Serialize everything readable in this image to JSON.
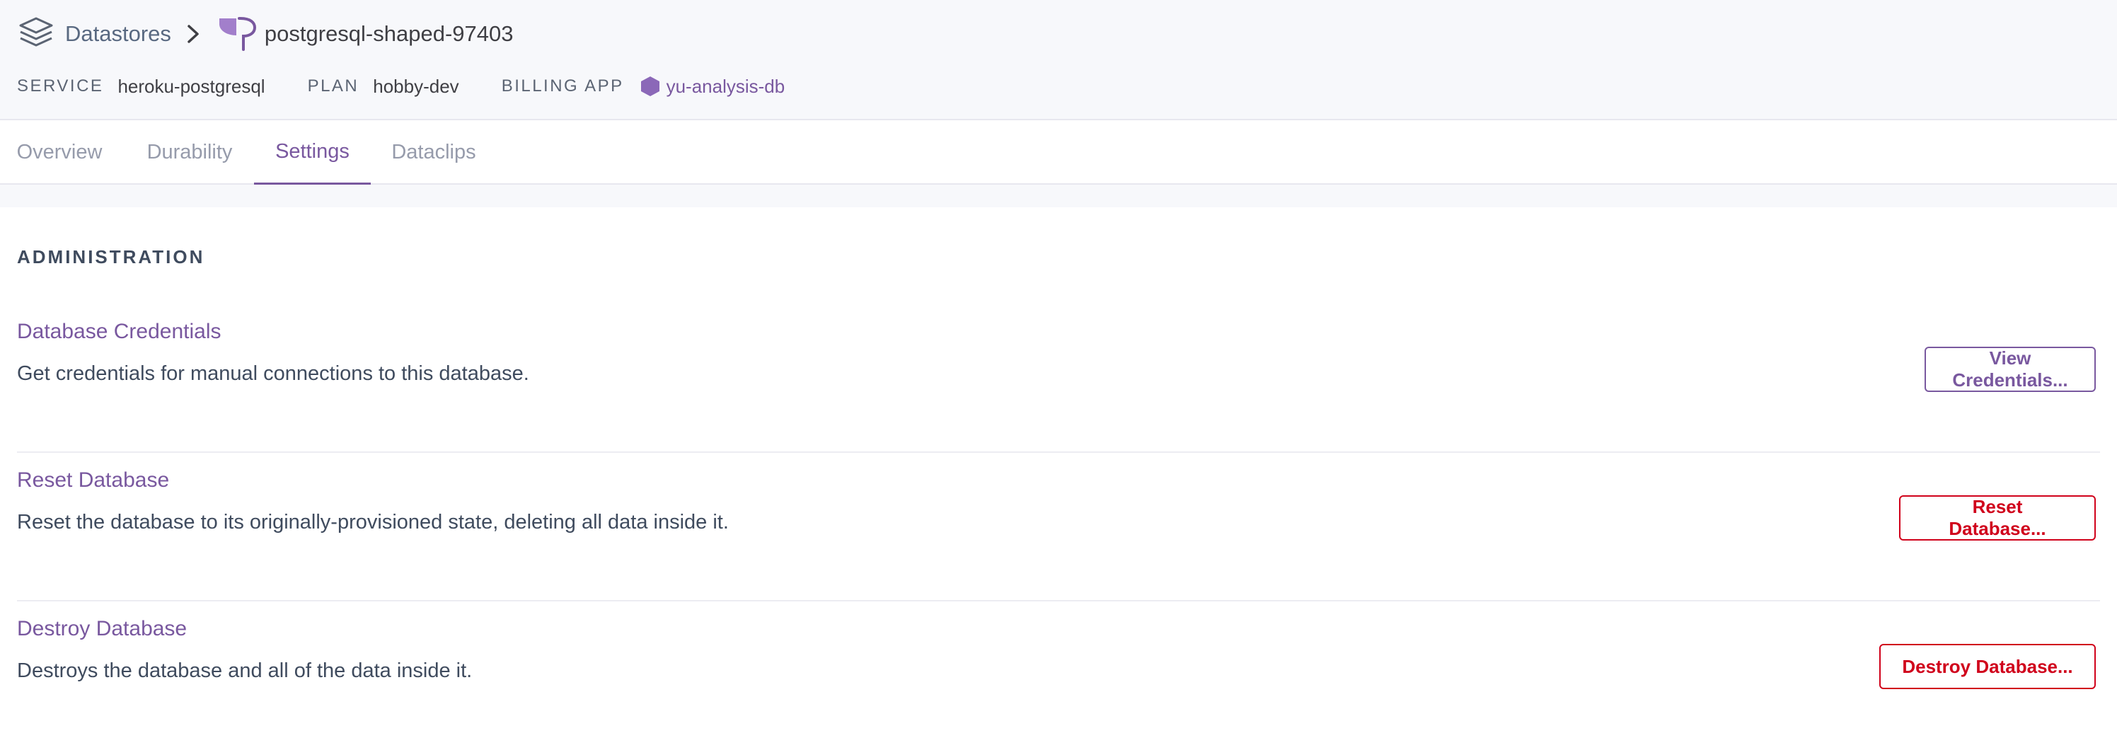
{
  "colors": {
    "brand_purple": "#79589f",
    "danger_red": "#d0021b",
    "header_bg": "#f7f8fb",
    "text_dark": "#3f4b5e"
  },
  "breadcrumb": {
    "root_icon": "datastores-stack-icon",
    "root_label": "Datastores",
    "separator_icon": "chevron-right-icon",
    "resource_icon": "postgres-elephant-icon",
    "resource_name": "postgresql-shaped-97403"
  },
  "meta": {
    "service_label": "SERVICE",
    "service_value": "heroku-postgresql",
    "plan_label": "PLAN",
    "plan_value": "hobby-dev",
    "billing_label": "BILLING APP",
    "billing_icon": "app-hexagon-icon",
    "billing_app": "yu-analysis-db"
  },
  "tabs": [
    {
      "label": "Overview",
      "active": false
    },
    {
      "label": "Durability",
      "active": false
    },
    {
      "label": "Settings",
      "active": true
    },
    {
      "label": "Dataclips",
      "active": false
    }
  ],
  "administration": {
    "heading": "ADMINISTRATION",
    "items": [
      {
        "title": "Database Credentials",
        "description": "Get credentials for manual connections to this database.",
        "button_label": "View Credentials...",
        "button_style": "neutral"
      },
      {
        "title": "Reset Database",
        "description": "Reset the database to its originally-provisioned state, deleting all data inside it.",
        "button_label": "Reset Database...",
        "button_style": "danger"
      },
      {
        "title": "Destroy Database",
        "description": "Destroys the database and all of the data inside it.",
        "button_label": "Destroy Database...",
        "button_style": "danger"
      }
    ]
  }
}
